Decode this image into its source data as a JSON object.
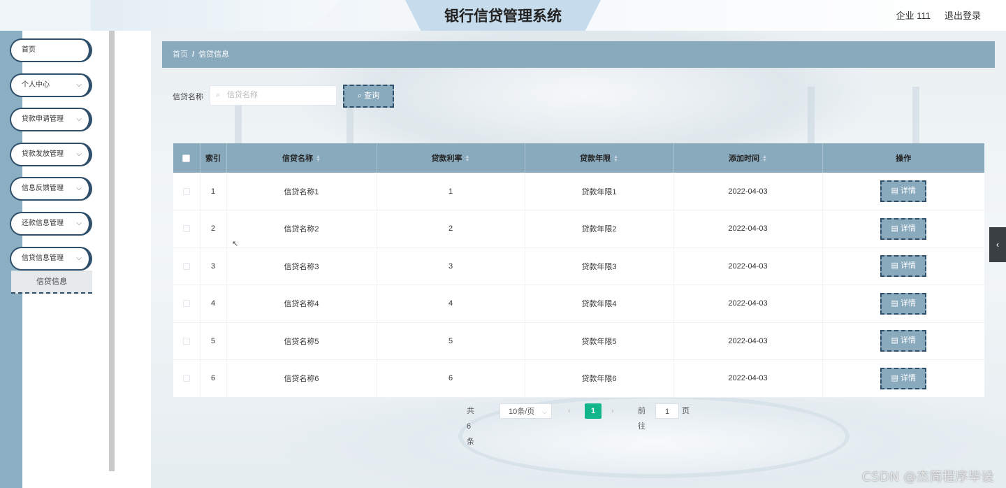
{
  "header": {
    "title": "银行信贷管理系统",
    "user": "企业 111",
    "logout": "退出登录"
  },
  "sidebar": {
    "items": [
      {
        "label": "首页",
        "has_arrow": false
      },
      {
        "label": "个人中心",
        "has_arrow": true
      },
      {
        "label": "贷款申请管理",
        "has_arrow": true
      },
      {
        "label": "贷款发放管理",
        "has_arrow": true
      },
      {
        "label": "信息反馈管理",
        "has_arrow": true
      },
      {
        "label": "还款信息管理",
        "has_arrow": true
      },
      {
        "label": "信贷信息管理",
        "has_arrow": true
      }
    ],
    "active_sub": "信贷信息"
  },
  "breadcrumb": {
    "home": "首页",
    "separator": "/",
    "current": "信贷信息"
  },
  "search": {
    "label": "信贷名称",
    "placeholder": "信贷名称",
    "button": "查询"
  },
  "table": {
    "columns": [
      "索引",
      "信贷名称",
      "贷款利率",
      "贷款年限",
      "添加时间",
      "操作"
    ],
    "detail_label": "详情",
    "rows": [
      {
        "index": "1",
        "name": "信贷名称1",
        "rate": "1",
        "term": "贷款年限1",
        "date": "2022-04-03"
      },
      {
        "index": "2",
        "name": "信贷名称2",
        "rate": "2",
        "term": "贷款年限2",
        "date": "2022-04-03"
      },
      {
        "index": "3",
        "name": "信贷名称3",
        "rate": "3",
        "term": "贷款年限3",
        "date": "2022-04-03"
      },
      {
        "index": "4",
        "name": "信贷名称4",
        "rate": "4",
        "term": "贷款年限4",
        "date": "2022-04-03"
      },
      {
        "index": "5",
        "name": "信贷名称5",
        "rate": "5",
        "term": "贷款年限5",
        "date": "2022-04-03"
      },
      {
        "index": "6",
        "name": "信贷名称6",
        "rate": "6",
        "term": "贷款年限6",
        "date": "2022-04-03"
      }
    ]
  },
  "pagination": {
    "total": "共 6 条",
    "page_size": "10条/页",
    "current_page": "1",
    "goto_label": "前往",
    "goto_value": "1",
    "page_unit": "页"
  },
  "watermark": "CSDN @杰简程序毕设",
  "colors": {
    "accent": "#89a9bd",
    "border_dark": "#2f4f6a",
    "page_active": "#13b58a"
  }
}
